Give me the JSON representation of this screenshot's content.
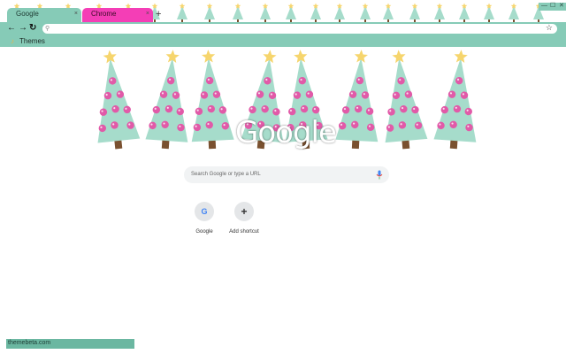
{
  "tabs": [
    {
      "title": "Google",
      "active": true
    },
    {
      "title": "Chrome",
      "active": false
    }
  ],
  "icons": {
    "tab_close": "close-icon",
    "new_tab": "plus-icon",
    "back": "back-arrow-icon",
    "forward": "forward-arrow-icon",
    "reload": "reload-icon",
    "search": "search-icon",
    "bookmark_star": "star-icon",
    "bookmark_folder": "theme-folder-icon",
    "mic": "microphone-icon"
  },
  "glyphs": {
    "close": "×",
    "new_tab": "+",
    "back": "←",
    "forward": "→",
    "reload": "↻",
    "search": "⚲",
    "star": "☆",
    "minimize": "—",
    "maximize": "☐",
    "window_close": "✕",
    "bookmark_folder": "♪",
    "add": "+"
  },
  "bookmarks": {
    "themes_label": "Themes"
  },
  "ntp": {
    "logo_text": "Google",
    "search_placeholder": "Search Google or type a URL",
    "shortcuts": [
      {
        "label": "Google",
        "glyph": "G"
      },
      {
        "label": "Add shortcut",
        "glyph": "+"
      }
    ]
  },
  "status": {
    "text": "themebeta.com"
  },
  "colors": {
    "theme_mint": "#86cbb7",
    "tab_pink": "#f43eb6",
    "tree_green": "#a6dccb",
    "ornament_pink": "#e15aa8",
    "star_yellow": "#f6d56d",
    "trunk_brown": "#7a5130"
  }
}
